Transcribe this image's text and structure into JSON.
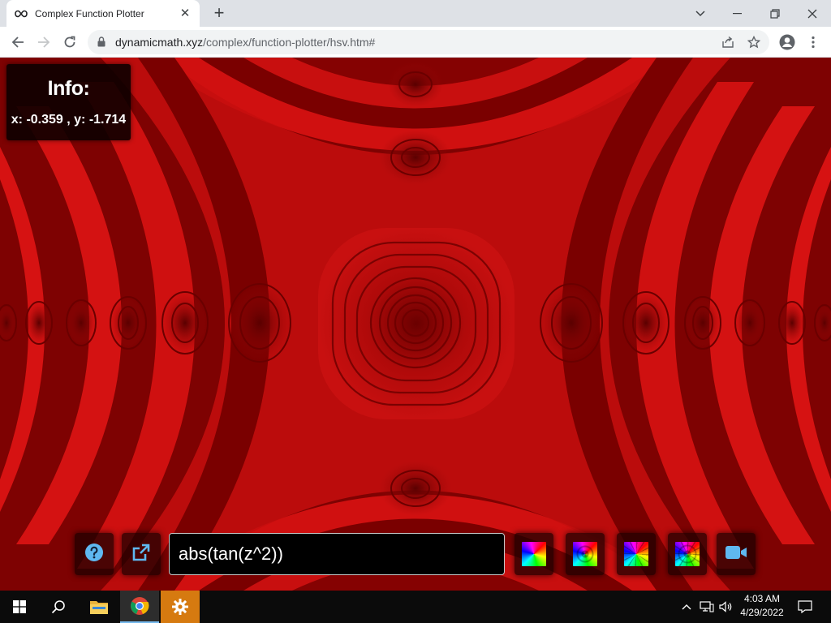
{
  "browser": {
    "tab_title": "Complex Function Plotter",
    "url_domain": "dynamicmath.xyz",
    "url_path": "/complex/function-plotter/hsv.htm#",
    "new_tab_label": "+",
    "tab_close_label": "✕"
  },
  "page": {
    "info_title": "Info:",
    "coords": "x: -0.359 , y: -1.714",
    "function_input": "abs(tan(z^2))",
    "colorwheel_count": 4
  },
  "taskbar": {
    "time": "4:03 AM",
    "date": "4/29/2022"
  },
  "colors": {
    "plot_dark": "#7a0000",
    "plot_bright": "#d41010",
    "accent_settings": "#d67a10"
  }
}
